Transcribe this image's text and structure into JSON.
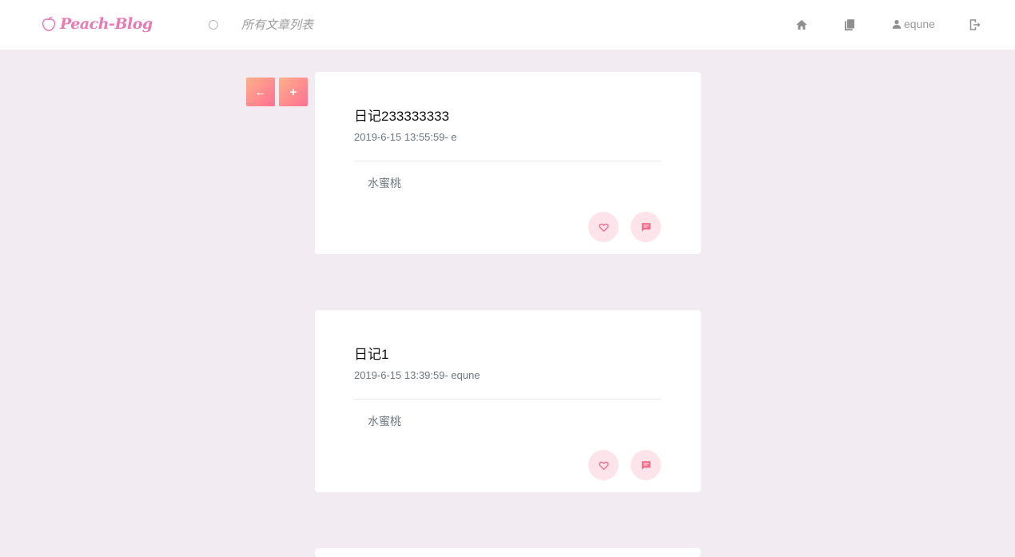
{
  "header": {
    "logo_text": "Peach-Blog",
    "page_heading": "所有文章列表",
    "user_name": "equne"
  },
  "actions": {
    "back_label": "←",
    "add_label": "+"
  },
  "posts": [
    {
      "title": "日记233333333",
      "meta": "2019-6-15 13:55:59- e",
      "body": "水蜜桃"
    },
    {
      "title": "日记1",
      "meta": "2019-6-15 13:39:59- equne",
      "body": "水蜜桃"
    }
  ],
  "colors": {
    "accent": "#e979b3",
    "button_gradient_start": "#ffb08a",
    "button_gradient_end": "#ff6f93",
    "page_background": "#f2ebf2",
    "action_circle": "#fde4ea",
    "action_icon": "#f56c8b"
  },
  "icons": {
    "logo": "peach-icon",
    "home": "home-icon",
    "books": "books-icon",
    "user": "user-icon",
    "logout": "logout-icon",
    "like": "heart-icon",
    "comment": "comment-icon"
  }
}
